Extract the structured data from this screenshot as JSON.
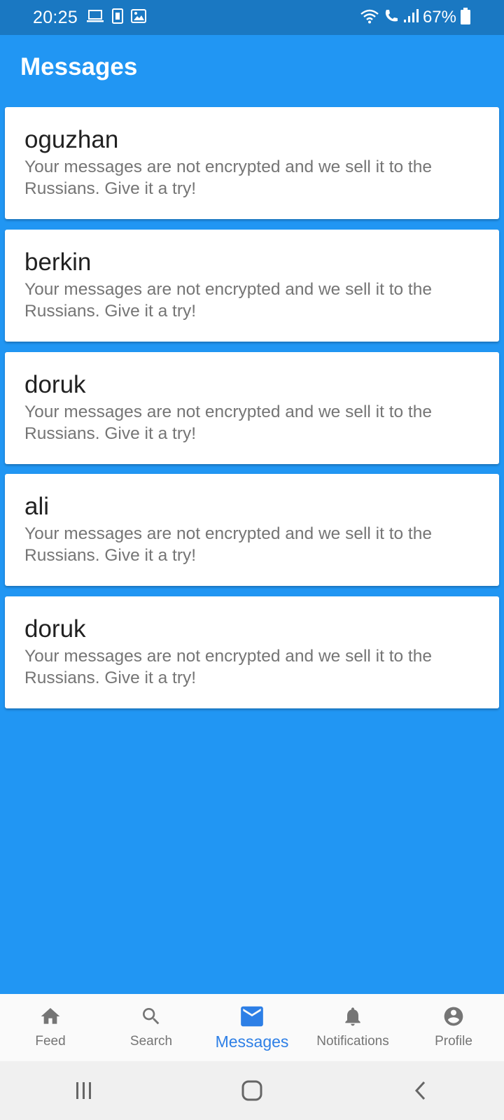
{
  "status_bar": {
    "time": "20:25",
    "left_icons": [
      "laptop-icon",
      "sim-card-icon",
      "image-icon"
    ],
    "right_icons": [
      "wifi-icon",
      "wifi-call-icon",
      "signal-icon",
      "battery-icon"
    ],
    "battery": "67%"
  },
  "header": {
    "title": "Messages",
    "background": "#2196f3"
  },
  "messages": [
    {
      "name": "oguzhan",
      "preview": "Your messages are not encrypted and we sell it to the Russians. Give it a try!"
    },
    {
      "name": "berkin",
      "preview": "Your messages are not encrypted and we sell it to the Russians. Give it a try!"
    },
    {
      "name": "doruk",
      "preview": "Your messages are not encrypted and we sell it to the Russians. Give it a try!"
    },
    {
      "name": "ali",
      "preview": "Your messages are not encrypted and we sell it to the Russians. Give it a try!"
    },
    {
      "name": "doruk",
      "preview": "Your messages are not encrypted and we sell it to the Russians. Give it a try!"
    }
  ],
  "bottom_nav": {
    "active": "Messages",
    "active_color": "#2d7fe6",
    "items": [
      {
        "label": "Feed",
        "icon": "home-icon"
      },
      {
        "label": "Search",
        "icon": "search-icon"
      },
      {
        "label": "Messages",
        "icon": "mail-icon"
      },
      {
        "label": "Notifications",
        "icon": "bell-icon"
      },
      {
        "label": "Profile",
        "icon": "account-circle-icon"
      }
    ]
  },
  "system_nav": [
    "recent-apps-icon",
    "home-button-icon",
    "back-icon"
  ]
}
